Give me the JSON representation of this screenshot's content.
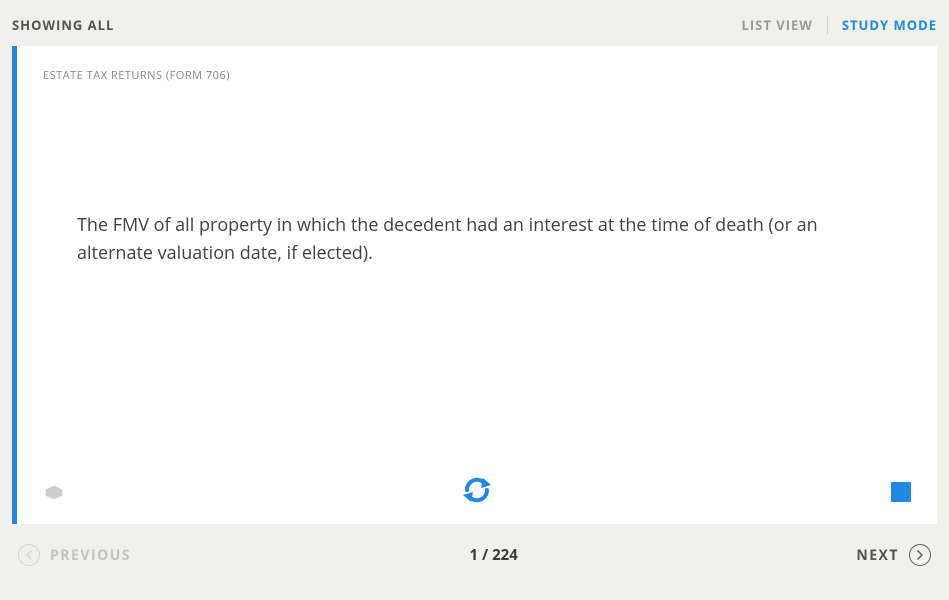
{
  "header": {
    "showing": "SHOWING ALL",
    "listView": "LIST VIEW",
    "studyMode": "STUDY MODE"
  },
  "card": {
    "category": "ESTATE TAX RETURNS (FORM 706)",
    "text": "The FMV of all property in which the decedent had an interest at the time of death (or an alternate valuation date, if elected).",
    "accentColor": "#1f89e5"
  },
  "nav": {
    "previous": "PREVIOUS",
    "next": "NEXT",
    "counter": "1 / 224"
  }
}
